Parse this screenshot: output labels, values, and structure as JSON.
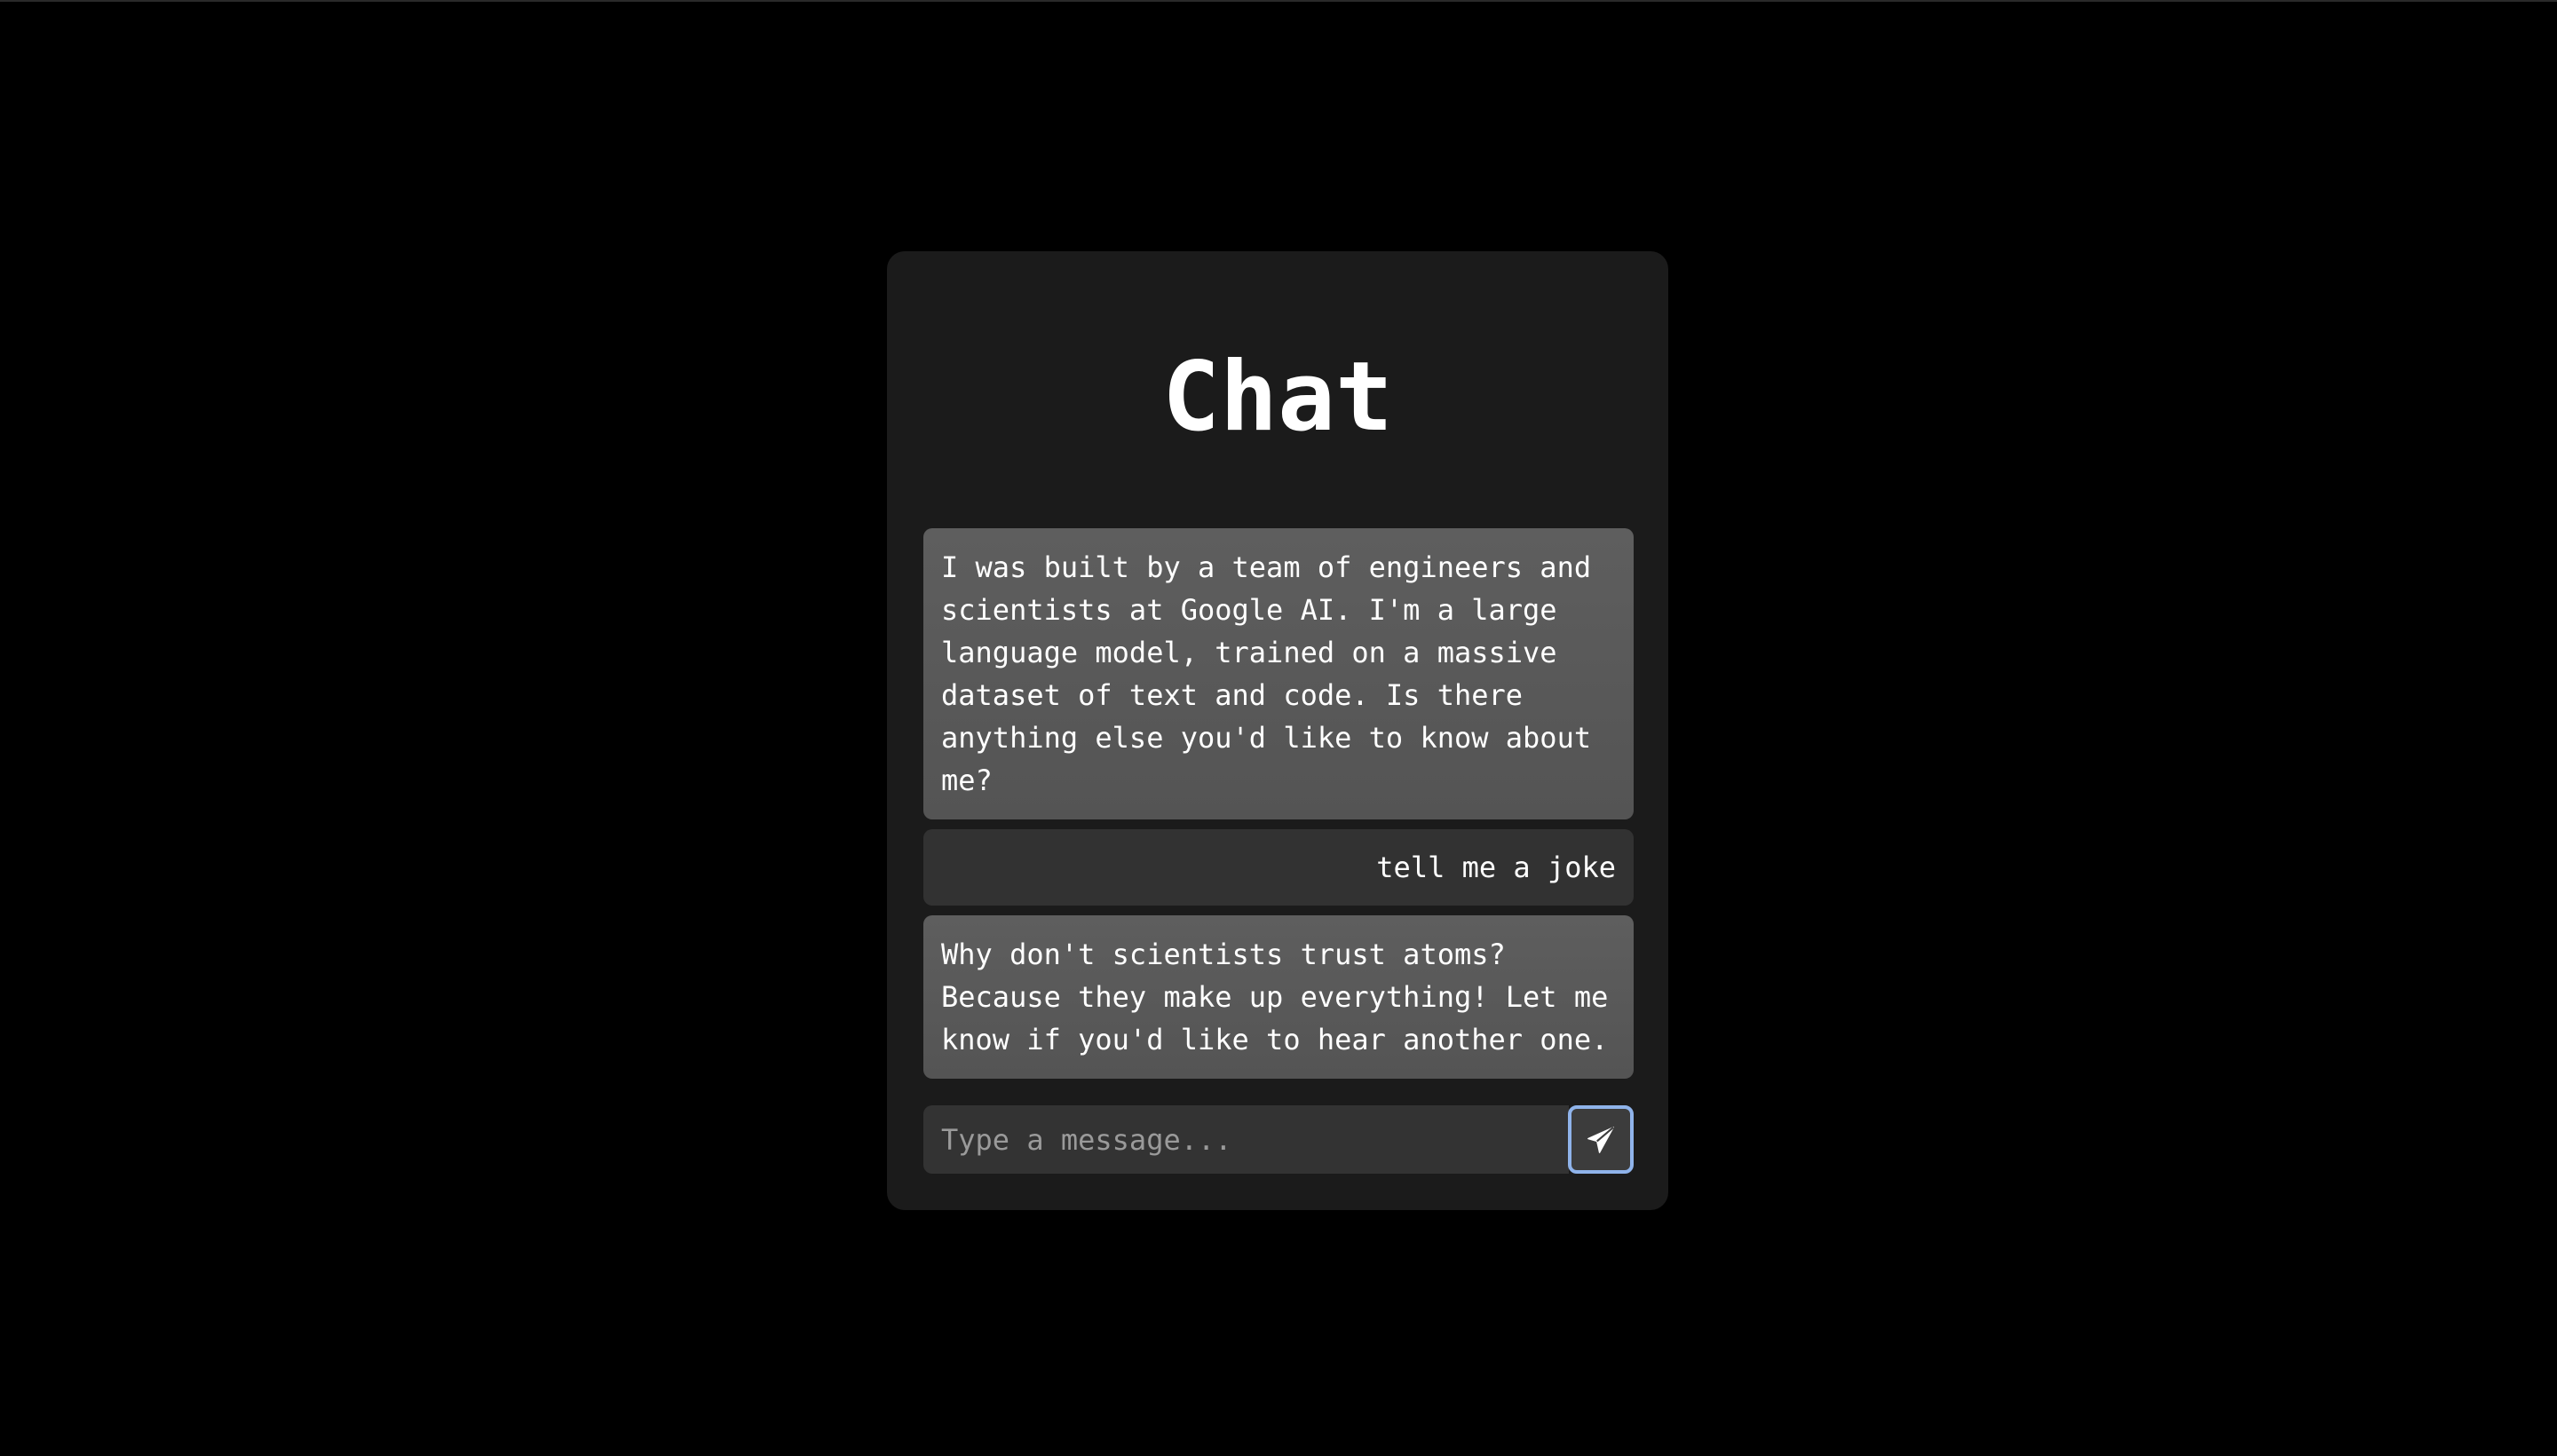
{
  "title": "Chat",
  "messages": [
    {
      "role": "bot",
      "text": "I was built by a team of engineers and scientists at Google AI. I'm a large language model, trained on a massive dataset of text and code. Is there anything else you'd like to know about me?"
    },
    {
      "role": "user",
      "text": "tell me a joke"
    },
    {
      "role": "bot",
      "text": "Why don't scientists trust atoms? Because they make up everything! Let me know if you'd like to hear another one."
    }
  ],
  "input": {
    "placeholder": "Type a message...",
    "value": ""
  },
  "send_icon": "paper-plane-icon",
  "colors": {
    "focus_border": "#8fb3ea"
  }
}
